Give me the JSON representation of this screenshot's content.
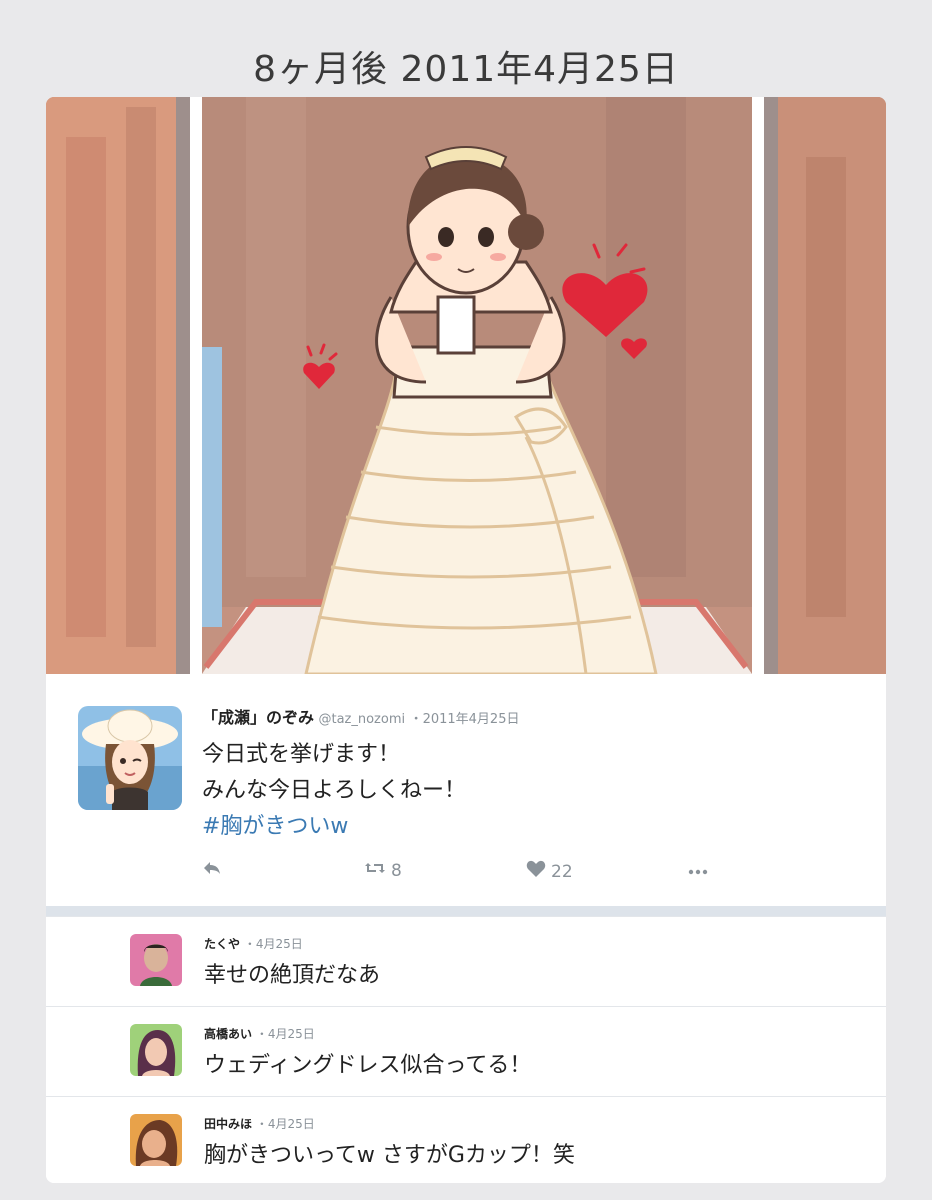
{
  "header": {
    "title": "8ヶ月後 2011年4月25日"
  },
  "tweet": {
    "display_name": "「成瀬」のぞみ",
    "handle": "@taz_nozomi",
    "separator": "・",
    "date": "2011年4月25日",
    "lines": [
      "今日式を挙げます！",
      "みんな今日よろしくねー！"
    ],
    "hashtag": "#胸がきついw",
    "retweet_count": "8",
    "like_count": "22",
    "icons": {
      "reply": "reply-arrow-icon",
      "retweet": "retweet-icon",
      "like": "heart-icon",
      "more": "more-dots-icon"
    }
  },
  "replies": [
    {
      "name": "たくや",
      "separator": "・",
      "date": "4月25日",
      "text": "幸せの絶頂だなあ"
    },
    {
      "name": "高橋あい",
      "separator": "・",
      "date": "4月25日",
      "text": "ウェディングドレス似合ってる！"
    },
    {
      "name": "田中みほ",
      "separator": "・",
      "date": "4月25日",
      "text": "胸がきついってw さすがGカップ！笑"
    }
  ],
  "colors": {
    "background": "#e9e9eb",
    "card": "#ffffff",
    "hashtag": "#3b7ab3",
    "meta": "#8a9299",
    "heart": "#e0283a"
  }
}
